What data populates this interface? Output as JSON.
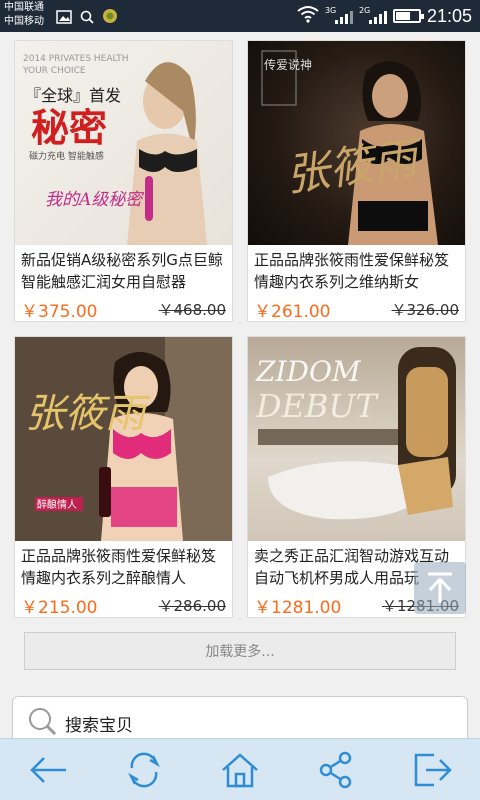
{
  "status": {
    "carrier1": "中国联通",
    "carrier2": "中国移动",
    "net1": "3G",
    "net2": "2G",
    "time": "21:05",
    "icons": [
      "image-icon",
      "search-icon",
      "app-icon",
      "wifi-icon",
      "signal-icon",
      "battery-icon"
    ]
  },
  "products": [
    {
      "title": "新品促销A级秘密系列G点巨鲸智能触感汇润女用自慰器",
      "price": "￥375.00",
      "old_price": "￥468.00",
      "image_text": {
        "line1": "2014 PRIVATES HEALTH",
        "line2": "YOUR CHOICE",
        "badge": "『全球』首发",
        "big": "秘密",
        "sub": "磁力充电  智能触感",
        "script": "我的A级秘密"
      }
    },
    {
      "title": "正品品牌张筱雨性爱保鲜秘笈情趣内衣系列之维纳斯女",
      "price": "￥261.00",
      "old_price": "￥326.00",
      "image_text": {
        "small": "传爱说神",
        "script": "张筱雨"
      }
    },
    {
      "title": "正品品牌张筱雨性爱保鲜秘笈情趣内衣系列之醉酿情人",
      "price": "￥215.00",
      "old_price": "￥286.00",
      "image_text": {
        "script": "张筱雨",
        "badge": "醉酿情人"
      }
    },
    {
      "title": "卖之秀正品汇润智动游戏互动自动飞机杯男成人用品玩",
      "price": "￥1281.00",
      "old_price": "￥1281.00",
      "image_text": {
        "line1": "ZIDOM",
        "line2": "DEBUT"
      }
    }
  ],
  "load_more": "加载更多...",
  "search": {
    "label": "搜索宝贝"
  },
  "nav": {
    "icons": [
      "back-arrow-icon",
      "refresh-icon",
      "home-icon",
      "share-icon",
      "exit-icon"
    ]
  },
  "colors": {
    "price": "#ff6a1a",
    "status_bar": "#1e2a38",
    "bottom_nav": "#d7e6f3"
  }
}
